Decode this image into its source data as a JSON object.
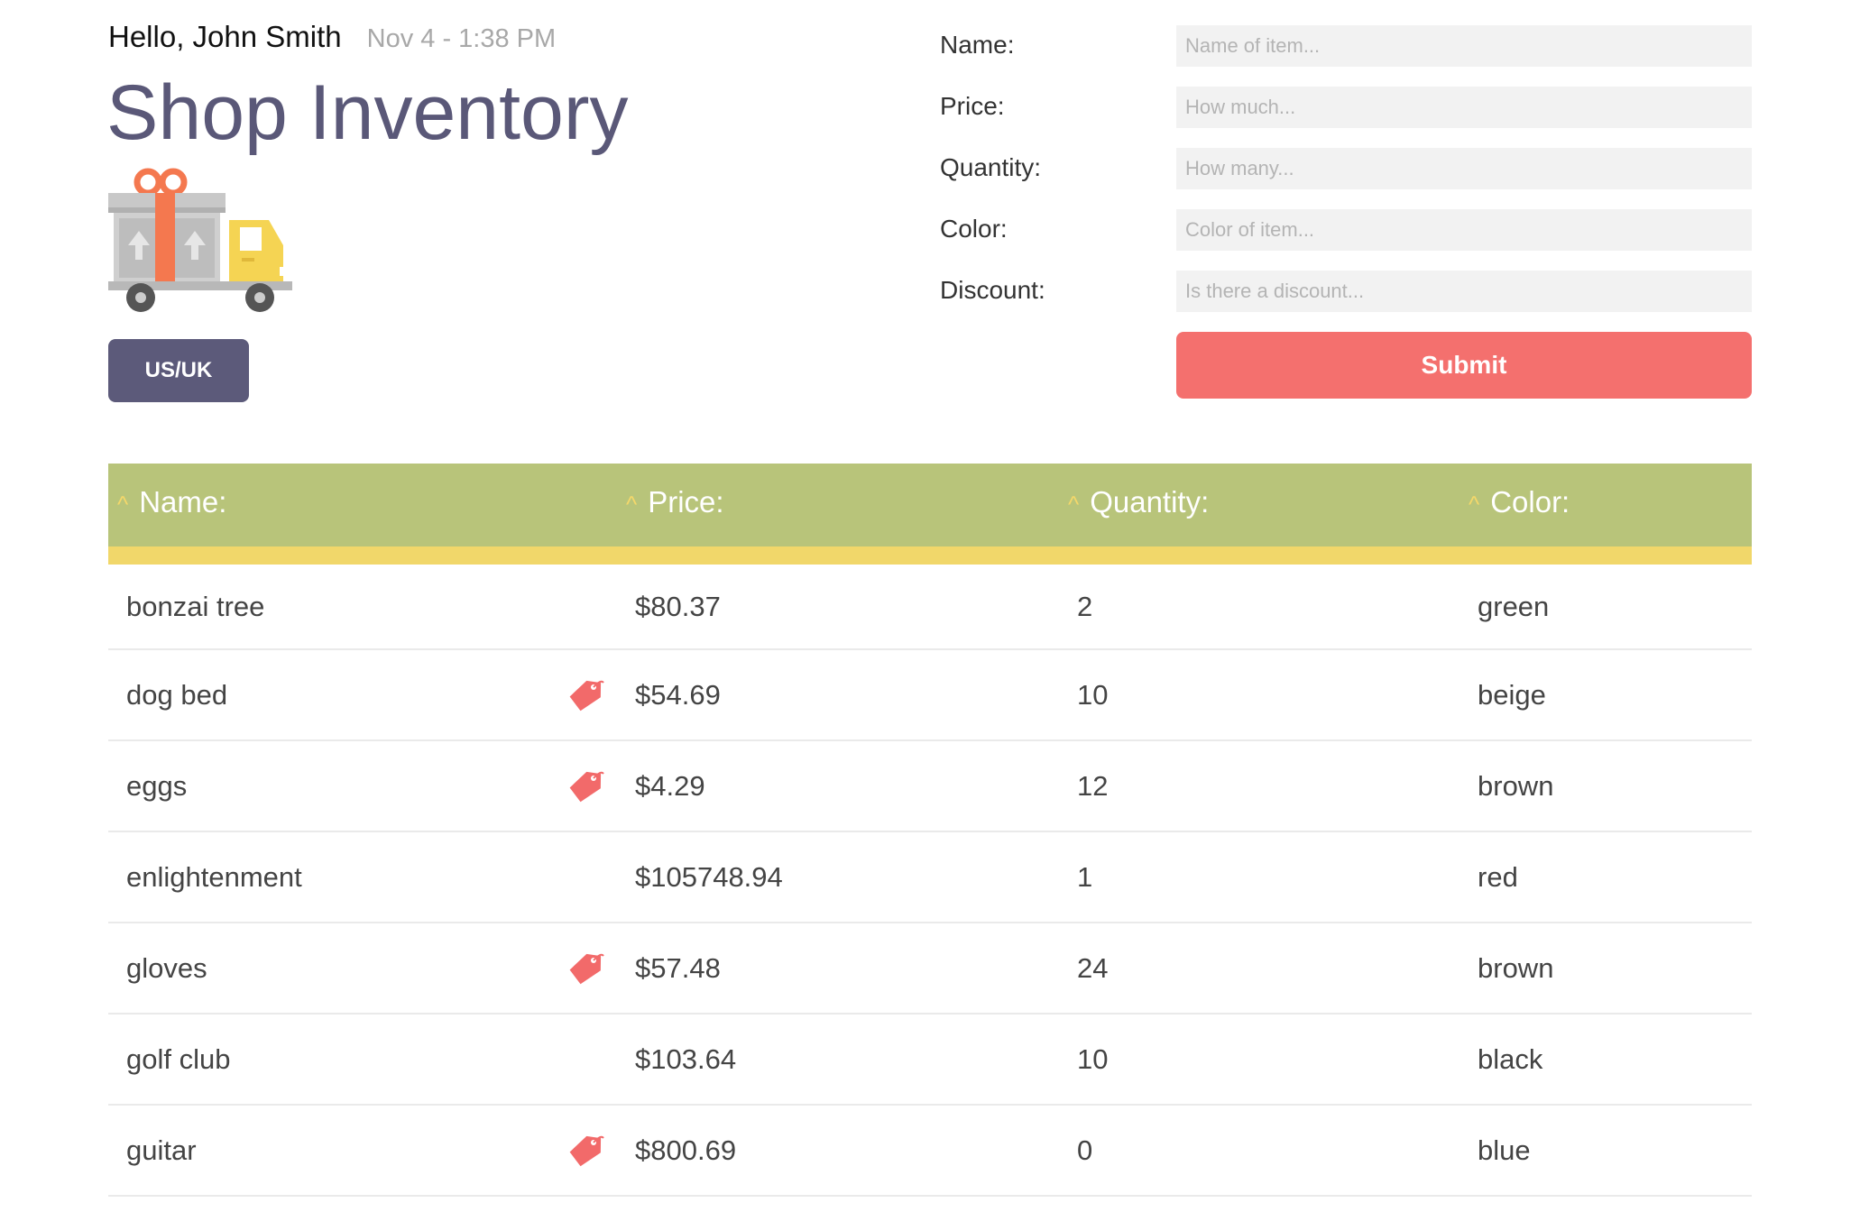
{
  "header": {
    "greeting": "Hello, John Smith",
    "timestamp": "Nov 4 - 1:38 PM",
    "title": "Shop Inventory",
    "locale_button": "US/UK"
  },
  "form": {
    "name_label": "Name:",
    "name_placeholder": "Name of item...",
    "price_label": "Price:",
    "price_placeholder": "How much...",
    "quantity_label": "Quantity:",
    "quantity_placeholder": "How many...",
    "color_label": "Color:",
    "color_placeholder": "Color of item...",
    "discount_label": "Discount:",
    "discount_placeholder": "Is there a discount...",
    "submit_label": "Submit"
  },
  "table": {
    "sort_symbol": "^",
    "columns": [
      "Name:",
      "Price:",
      "Quantity:",
      "Color:"
    ],
    "rows": [
      {
        "name": "bonzai tree",
        "price": "$80.37",
        "quantity": "2",
        "color": "green",
        "discount": false
      },
      {
        "name": "dog bed",
        "price": "$54.69",
        "quantity": "10",
        "color": "beige",
        "discount": true
      },
      {
        "name": "eggs",
        "price": "$4.29",
        "quantity": "12",
        "color": "brown",
        "discount": true
      },
      {
        "name": "enlightenment",
        "price": "$105748.94",
        "quantity": "1",
        "color": "red",
        "discount": false
      },
      {
        "name": "gloves",
        "price": "$57.48",
        "quantity": "24",
        "color": "brown",
        "discount": true
      },
      {
        "name": "golf club",
        "price": "$103.64",
        "quantity": "10",
        "color": "black",
        "discount": false
      },
      {
        "name": "guitar",
        "price": "$800.69",
        "quantity": "0",
        "color": "blue",
        "discount": true
      }
    ]
  },
  "icons": {
    "truck": "delivery-truck-gift-icon",
    "discount": "price-tag-icon"
  },
  "colors": {
    "accent_purple": "#5c5a7a",
    "submit_red": "#f4706e",
    "header_green": "#b8c47a",
    "header_stripe_yellow": "#f1d76a",
    "tag_red": "#f26a6a"
  }
}
